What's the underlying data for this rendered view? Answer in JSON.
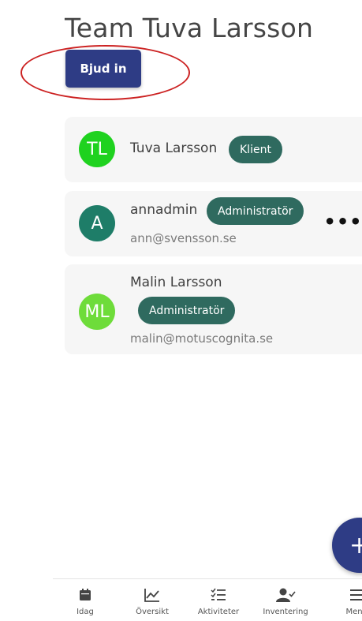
{
  "header": {
    "title": "Team Tuva Larsson",
    "invite_label": "Bjud in"
  },
  "members": [
    {
      "initials": "TL",
      "name": "Tuva Larsson",
      "role": "Klient",
      "email": "",
      "avatar_color": "#1fd21f"
    },
    {
      "initials": "A",
      "name": "annadmin",
      "role": "Administratör",
      "email": "ann@svensson.se",
      "avatar_color": "#1e7d68"
    },
    {
      "initials": "ML",
      "name": "Malin Larsson",
      "role": "Administratör",
      "email": "malin@motuscognita.se",
      "avatar_color": "#6edc3a"
    }
  ],
  "more_label": "•••",
  "fab_label": "+",
  "nav": [
    {
      "label": "Idag",
      "icon": "calendar-icon"
    },
    {
      "label": "Översikt",
      "icon": "chart-icon"
    },
    {
      "label": "Aktiviteter",
      "icon": "checklist-icon"
    },
    {
      "label": "Inventering",
      "icon": "person-check-icon"
    },
    {
      "label": "Meny",
      "icon": "menu-icon"
    }
  ],
  "colors": {
    "primary": "#2e3c85",
    "badge": "#2f6a5f",
    "annotation": "#cc2222"
  }
}
